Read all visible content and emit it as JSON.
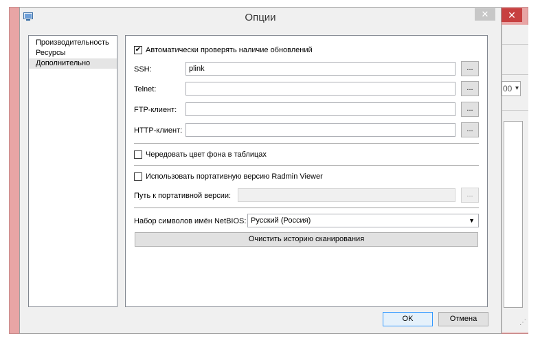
{
  "window": {
    "title": "Опции",
    "close_glyph": "✕"
  },
  "background_window": {
    "combo_value": "00"
  },
  "nav": {
    "items": [
      {
        "label": "Производительность"
      },
      {
        "label": "Ресурсы"
      },
      {
        "label": "Дополнительно",
        "selected": true
      }
    ]
  },
  "content": {
    "auto_update": {
      "label": "Автоматически проверять наличие обновлений",
      "checked": true
    },
    "fields": [
      {
        "label": "SSH:",
        "value": "plink"
      },
      {
        "label": "Telnet:",
        "value": ""
      },
      {
        "label": "FTP-клиент:",
        "value": ""
      },
      {
        "label": "HTTP-клиент:",
        "value": ""
      }
    ],
    "browse_label": "...",
    "alternate_rows": {
      "label": "Чередовать цвет фона в таблицах",
      "checked": false
    },
    "portable": {
      "label": "Использовать портативную версию Radmin Viewer",
      "checked": false
    },
    "portable_path": {
      "label": "Путь к портативной версии:",
      "value": ""
    },
    "netbios": {
      "label": "Набор символов имён NetBIOS:",
      "value": "Русский (Россия)"
    },
    "clear_history_label": "Очистить историю сканирования"
  },
  "footer": {
    "ok_label": "OK",
    "cancel_label": "Отмена"
  }
}
